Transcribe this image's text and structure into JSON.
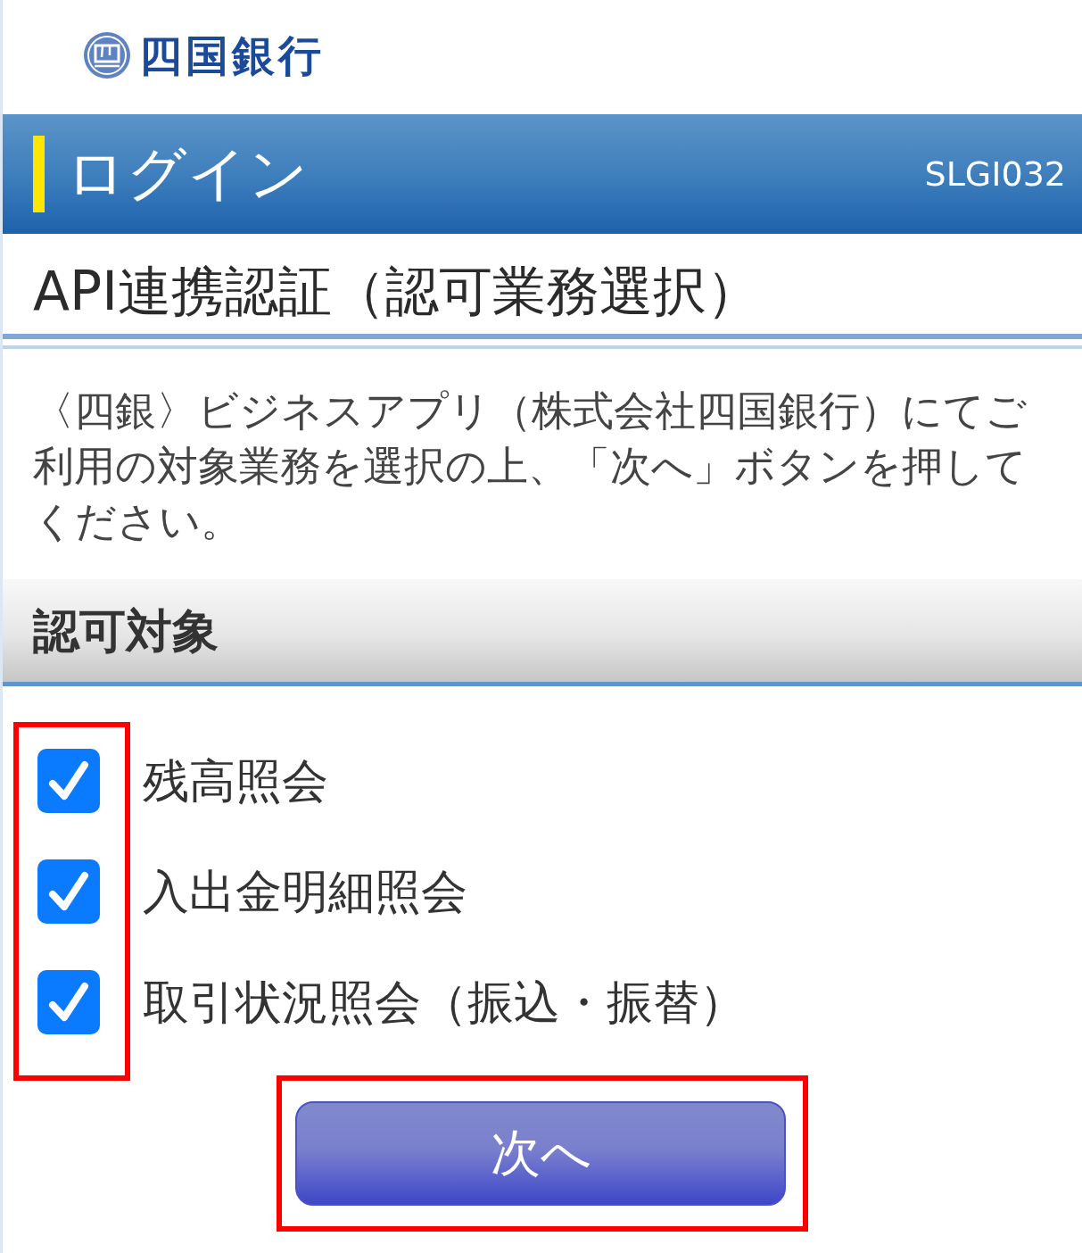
{
  "logo": {
    "text": "四国銀行"
  },
  "header": {
    "title": "ログイン",
    "screen_id": "SLGI032"
  },
  "page_title": "API連携認証（認可業務選択）",
  "instructions": "〈四銀〉ビジネスアプリ（株式会社四国銀行）にてご利用の対象業務を選択の上、「次へ」ボタンを押してください。",
  "section": {
    "title": "認可対象"
  },
  "permissions": [
    {
      "label": "残高照会",
      "checked": true
    },
    {
      "label": "入出金明細照会",
      "checked": true
    },
    {
      "label": "取引状況照会（振込・振替）",
      "checked": true
    }
  ],
  "next_button": {
    "label": "次へ"
  },
  "highlights": {
    "checkboxes": true,
    "next_button": true
  }
}
